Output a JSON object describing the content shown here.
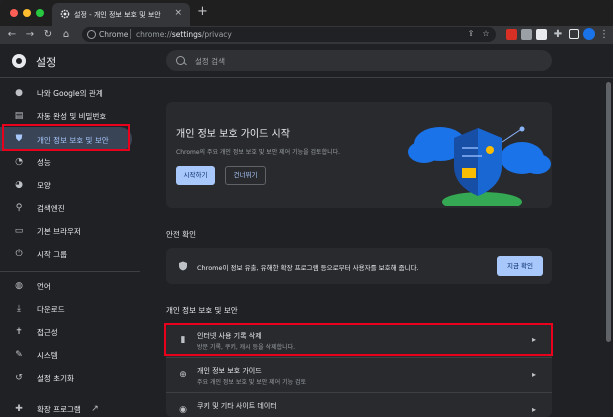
{
  "tab": {
    "title": "설정 - 개인 정보 보호 및 보안",
    "close": "×",
    "new_tab": "+"
  },
  "omnibox": {
    "chip": "Chrome",
    "url_prefix": "chrome://",
    "url_path": "settings",
    "url_suffix": "/privacy"
  },
  "header": {
    "title": "설정"
  },
  "search": {
    "placeholder": "설정 검색"
  },
  "sidebar": {
    "items": [
      {
        "label": "나와 Google의 관계",
        "icon": "person-icon"
      },
      {
        "label": "자동 완성 및 비밀번호",
        "icon": "clipboard-icon"
      },
      {
        "label": "개인 정보 보호 및 보안",
        "icon": "shield-icon",
        "active": true
      },
      {
        "label": "성능",
        "icon": "speedometer-icon"
      },
      {
        "label": "모양",
        "icon": "palette-icon"
      },
      {
        "label": "검색엔진",
        "icon": "search-icon"
      },
      {
        "label": "기본 브라우저",
        "icon": "browser-icon"
      },
      {
        "label": "시작 그룹",
        "icon": "power-icon"
      },
      {
        "label": "언어",
        "icon": "globe-icon"
      },
      {
        "label": "다운로드",
        "icon": "download-icon"
      },
      {
        "label": "접근성",
        "icon": "accessibility-icon"
      },
      {
        "label": "시스템",
        "icon": "wrench-icon"
      },
      {
        "label": "설정 초기화",
        "icon": "history-icon"
      },
      {
        "label": "확장 프로그램",
        "icon": "puzzle-icon"
      }
    ]
  },
  "hero": {
    "title": "개인 정보 보호 가이드 시작",
    "subtitle": "Chrome의 주요 개인 정보 보호 및 보안 제어 기능을 검토합니다.",
    "primary_label": "시작하기",
    "secondary_label": "건너뛰기"
  },
  "safety": {
    "section_label": "안전 확인",
    "text": "Chrome이 정보 유출, 유해한 확장 프로그램 등으로부터 사용자를 보호해 줍니다.",
    "button_label": "지금 확인"
  },
  "privacy": {
    "section_label": "개인 정보 보호 및 보안",
    "rows": [
      {
        "title": "인터넷 사용 기록 삭제",
        "subtitle": "방문 기록, 쿠키, 캐시 등을 삭제합니다.",
        "icon": "trash-icon"
      },
      {
        "title": "개인 정보 보호 가이드",
        "subtitle": "주요 개인 정보 보호 및 보안 제어 기능 검토",
        "icon": "add-circle-icon"
      },
      {
        "title": "쿠키 및 기타 사이트 데이터",
        "subtitle": "",
        "icon": "cookie-icon"
      }
    ]
  },
  "colors": {
    "accent": "#a8c7fa",
    "highlight": "#e8001c",
    "background": "#202124",
    "card": "#292a2d"
  }
}
